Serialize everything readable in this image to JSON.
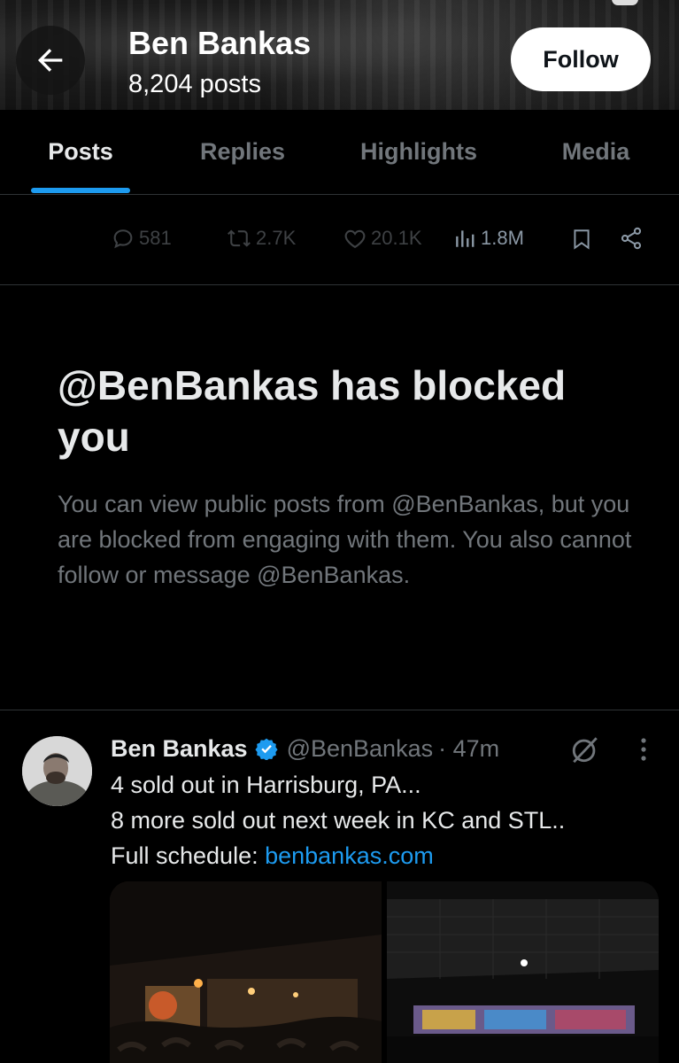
{
  "header": {
    "profile_name": "Ben Bankas",
    "post_count": "8,204 posts",
    "follow_label": "Follow"
  },
  "tabs": [
    {
      "label": "Posts",
      "active": true
    },
    {
      "label": "Replies",
      "active": false
    },
    {
      "label": "Highlights",
      "active": false
    },
    {
      "label": "Media",
      "active": false
    }
  ],
  "engagement": {
    "replies": "581",
    "reposts": "2.7K",
    "likes": "20.1K",
    "views": "1.8M"
  },
  "blocked_notice": {
    "title": "@BenBankas has blocked you",
    "body": "You can view public posts from @BenBankas, but you are blocked from engaging with them. You also cannot follow or message @BenBankas."
  },
  "tweet": {
    "author_name": "Ben Bankas",
    "handle": "@BenBankas",
    "time": "· 47m",
    "lines": [
      "4 sold out in Harrisburg, PA...",
      "8 more sold out next week in KC and STL.."
    ],
    "schedule_prefix": "Full schedule: ",
    "link": "benbankas.com"
  },
  "colors": {
    "accent": "#1d9bf0",
    "background": "#000000",
    "secondary_text": "#71767b"
  },
  "icons": {
    "back": "arrow-left-icon",
    "reply": "speech-bubble-icon",
    "repost": "repost-icon",
    "like": "heart-icon",
    "views": "bar-chart-icon",
    "bookmark": "bookmark-icon",
    "share": "share-icon",
    "verified": "verified-badge-icon",
    "grok": "grok-icon",
    "more": "more-vertical-icon"
  }
}
